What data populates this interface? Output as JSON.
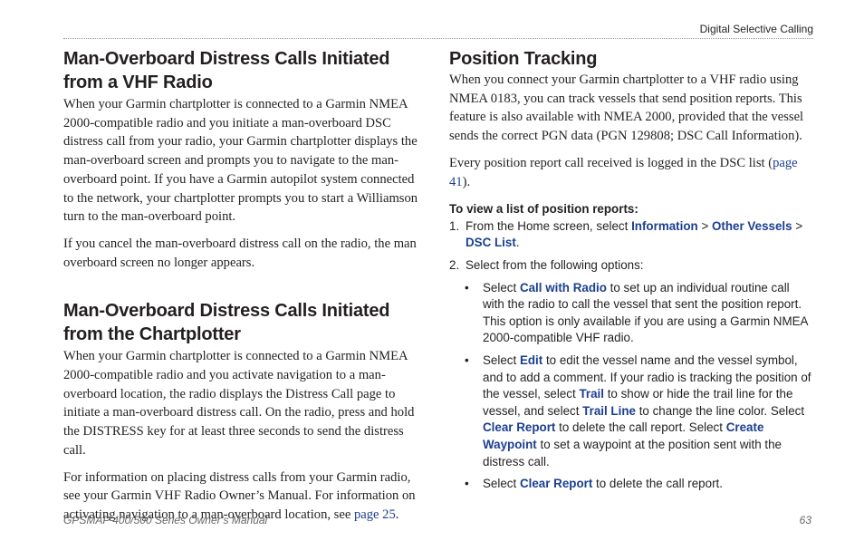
{
  "header": {
    "section": "Digital Selective Calling"
  },
  "left": {
    "s1_title_1": "Man-Overboard Distress Calls Initiated",
    "s1_title_2": "from a VHF Radio",
    "s1_p1": "When your Garmin chartplotter is connected to a Garmin NMEA 2000-compatible radio and you initiate a man-overboard DSC distress call from your radio, your Garmin chartplotter displays the man-overboard screen and prompts you to navigate to the man-overboard point. If you have a Garmin autopilot system connected to the network, your chartplotter prompts you to start a Williamson turn to the man-overboard point.",
    "s1_p2": "If you cancel the man-overboard distress call on the radio, the man overboard screen no longer appears.",
    "s2_title_1": "Man-Overboard Distress Calls Initiated",
    "s2_title_2": "from the Chartplotter",
    "s2_p1": "When your Garmin chartplotter is connected to a Garmin NMEA 2000-compatible radio and you activate navigation to a man-overboard location, the radio displays the Distress Call page to initiate a man-overboard distress call. On the radio, press and hold the DISTRESS key for at least three seconds to send the distress call.",
    "s2_p2_text": "For information on placing distress calls from your Garmin radio, see your Garmin VHF Radio Owner’s Manual. For information on activating navigation to a man-overboard location, see ",
    "s2_p2_link": "page 25",
    "s2_p2_end": "."
  },
  "right": {
    "title": "Position Tracking",
    "p1": "When you connect your Garmin chartplotter to a VHF radio using NMEA 0183, you can track vessels that send position reports. This feature is also available with NMEA 2000, provided that the vessel sends the correct PGN data (PGN 129808; DSC Call Information).",
    "p2_text": "Every position report call received is logged in the DSC list (",
    "p2_link": "page 41",
    "p2_end": ").",
    "procedure_title": "To view a list of position reports:",
    "step1": {
      "num": "1.",
      "text": "From the Home screen, select ",
      "ui1": "Information",
      "sep1": " > ",
      "ui2": "Other Vessels",
      "sep2": " >",
      "ui3": "DSC List",
      "end": "."
    },
    "step2": {
      "num": "2.",
      "text": "Select from the following options:"
    },
    "bullets": [
      {
        "pre": "Select ",
        "ui": "Call with Radio",
        "post": " to set up an individual routine call with the radio to call the vessel that sent the position report. This option is only available if you are using a Garmin NMEA 2000-compatible VHF radio."
      },
      {
        "a": "Select ",
        "ui1": "Edit",
        "b": " to edit the vessel name and the vessel symbol, and to add a comment. If your radio is tracking the position of the vessel, select ",
        "ui2": "Trail",
        "c": " to show or hide the trail line for the vessel, and select ",
        "ui3": "Trail Line",
        "d": " to change the line color. Select ",
        "ui4": "Clear Report",
        "e": " to delete the call report. Select ",
        "ui5": "Create Waypoint",
        "f": " to set a waypoint at the position sent with the distress call."
      },
      {
        "pre": "Select ",
        "ui": "Clear Report",
        "post": " to delete the call report."
      }
    ],
    "bullet_symbol": "•"
  },
  "footer": {
    "manual": "GPSMAP 400/500 Series Owner’s Manual",
    "page": "63"
  },
  "colors": {
    "text": "#231f20",
    "ui_link": "#1b3f8f"
  }
}
